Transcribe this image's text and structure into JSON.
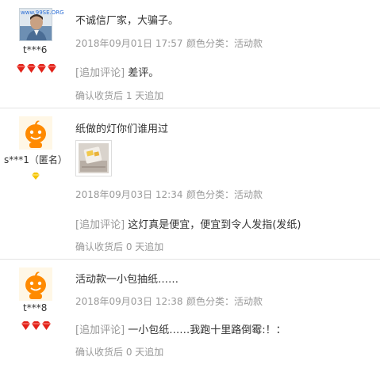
{
  "reviews": [
    {
      "user": "t***6",
      "watermark": "www.99SE.ORG",
      "content": "不诚信厂家，大骗子。",
      "date": "2018年09月01日 17:57",
      "color_label": "颜色分类：活动款",
      "append_tag": "[追加评论]",
      "append_text": "差评。",
      "append_confirm": "确认收货后 1 天追加",
      "badge_count": 4
    },
    {
      "user": "s***1（匿名）",
      "content": "纸做的灯你们谁用过",
      "date": "2018年09月03日 12:34",
      "color_label": "颜色分类：活动款",
      "append_tag": "[追加评论]",
      "append_text": "这灯真是便宜，便宜到令人发指(发纸)",
      "append_confirm": "确认收货后 0 天追加",
      "badge_count": 1
    },
    {
      "user": "t***8",
      "content": "活动款一小包抽纸……",
      "date": "2018年09月03日 12:38",
      "color_label": "颜色分类：活动款",
      "append_tag": "[追加评论]",
      "append_text": "一小包纸……我跑十里路倒霉:！：",
      "append_confirm": "确认收货后 0 天追加",
      "badge_count": 3
    }
  ],
  "colors": {
    "badge_red": "#e2231a",
    "badge_yellow": "#f5c400",
    "avatar_orange": "#ff8a00",
    "text_gray": "#999999"
  }
}
